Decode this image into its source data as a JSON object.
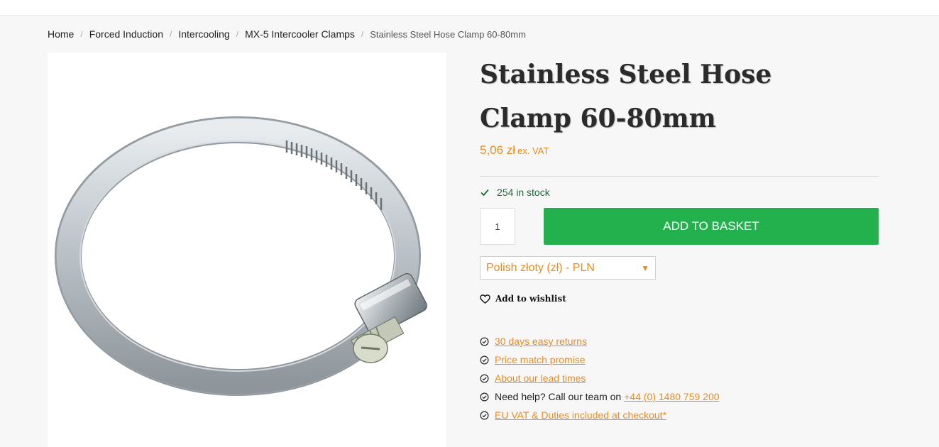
{
  "breadcrumb": {
    "items": [
      "Home",
      "Forced Induction",
      "Intercooling",
      "MX-5 Intercooler Clamps"
    ],
    "current": "Stainless Steel Hose Clamp 60-80mm",
    "separator": "/"
  },
  "product": {
    "title": "Stainless Steel Hose Clamp 60-80mm",
    "price": "5,06 zł",
    "price_suffix": "ex. VAT",
    "stock": "254 in stock",
    "quantity": "1",
    "add_to_basket": "ADD TO BASKET",
    "currency_selected": "Polish złoty (zł) - PLN",
    "wishlist": "Add to wishlist"
  },
  "benefits": {
    "returns": "30 days easy returns",
    "price_match": "Price match promise",
    "lead_times": "About our lead times",
    "help_prefix": "Need help? Call our team on",
    "phone": "+44 (0) 1480 759 200",
    "vat": "EU VAT & Duties included at checkout*"
  },
  "icons": {
    "stock": "check-icon",
    "wishlist": "heart-icon",
    "benefit": "check-circle-icon",
    "currency": "triangle-down-icon"
  },
  "colors": {
    "accent": "#e58c23",
    "button": "#22b14c",
    "stock": "#1e6b3a"
  }
}
